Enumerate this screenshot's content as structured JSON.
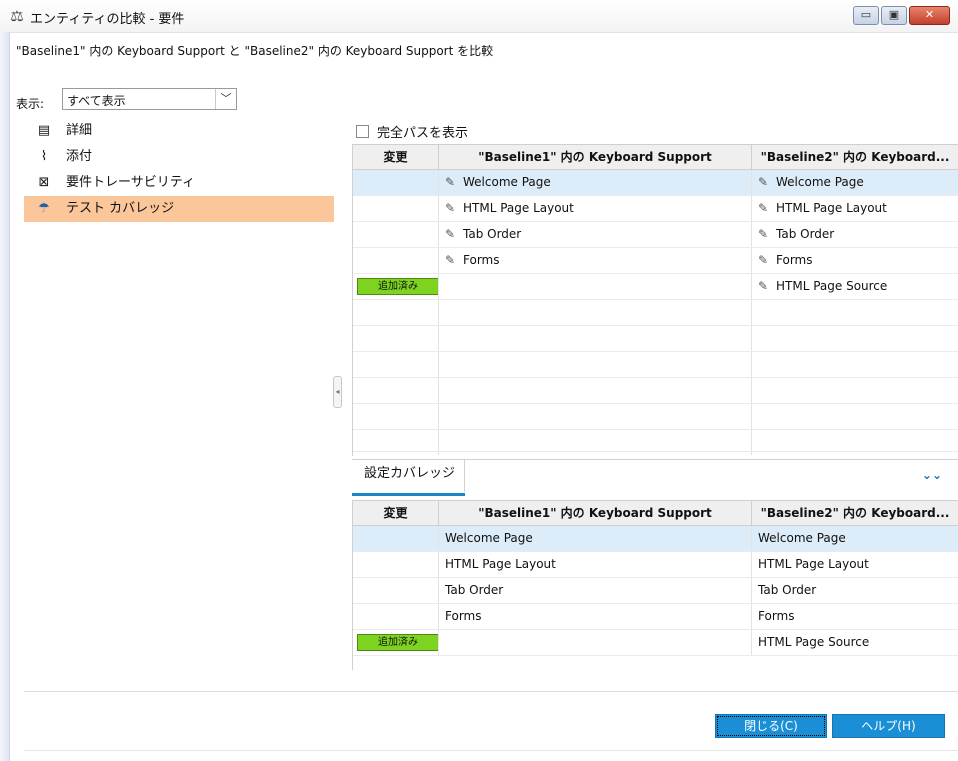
{
  "window": {
    "title": "エンティティの比較 - 要件",
    "title_icon": "scales-icon",
    "buttons": {
      "minimize": "▭",
      "maximize": "▣",
      "close": "✕"
    }
  },
  "subtitle": "\"Baseline1\" 内の Keyboard Support と \"Baseline2\" 内の Keyboard Support を比較",
  "filter": {
    "label": "表示:",
    "value": "すべて表示"
  },
  "nav": [
    {
      "label": "詳細",
      "icon": "details-icon",
      "glyph": "▤"
    },
    {
      "label": "添付",
      "icon": "paperclip-icon",
      "glyph": "⌇"
    },
    {
      "label": "要件トレーサビリティ",
      "icon": "traceability-icon",
      "glyph": "⊠"
    },
    {
      "label": "テスト カバレッジ",
      "icon": "umbrella-icon",
      "glyph": "☂"
    }
  ],
  "full_path_label": "完全パスを表示",
  "top_grid": {
    "headers": [
      "変更",
      "\"Baseline1\" 内の Keyboard Support",
      "\"Baseline2\" 内の Keyboard..."
    ],
    "rows": [
      {
        "change": "",
        "b1": "Welcome Page",
        "b2": "Welcome Page",
        "selected": true
      },
      {
        "change": "",
        "b1": "HTML Page Layout",
        "b2": "HTML Page Layout"
      },
      {
        "change": "",
        "b1": "Tab Order",
        "b2": "Tab Order"
      },
      {
        "change": "",
        "b1": "Forms",
        "b2": "Forms"
      },
      {
        "change": "追加済み",
        "b1": "",
        "b2": "HTML Page Source"
      }
    ]
  },
  "tab": {
    "label": "設定カバレッジ"
  },
  "bottom_grid": {
    "headers": [
      "変更",
      "\"Baseline1\" 内の Keyboard Support",
      "\"Baseline2\" 内の Keyboard..."
    ],
    "rows": [
      {
        "change": "",
        "b1": "Welcome Page",
        "b2": "Welcome Page",
        "selected": true
      },
      {
        "change": "",
        "b1": "HTML Page Layout",
        "b2": "HTML Page Layout"
      },
      {
        "change": "",
        "b1": "Tab Order",
        "b2": "Tab Order"
      },
      {
        "change": "",
        "b1": "Forms",
        "b2": "Forms"
      },
      {
        "change": "追加済み",
        "b1": "",
        "b2": "HTML Page Source"
      }
    ]
  },
  "buttons": {
    "close": "閉じる(C)",
    "help": "ヘルプ(H)"
  }
}
